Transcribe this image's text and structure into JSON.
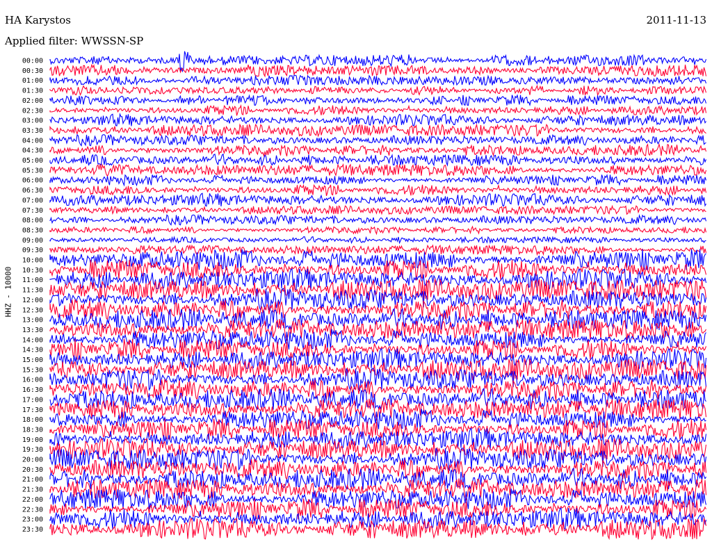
{
  "header": {
    "station": "HA Karystos",
    "date": "2011-11-13",
    "filter": "Applied filter: WWSSN-SP"
  },
  "chart_data": {
    "type": "line",
    "title": "HA Karystos",
    "subtitle": "Applied filter: WWSSN-SP",
    "date": "2011-11-13",
    "ylabel": "HHZ - 10000",
    "xlabel": "",
    "row_start_labels": [
      "00:00",
      "00:30",
      "01:00",
      "01:30",
      "02:00",
      "02:30",
      "03:00",
      "03:30",
      "04:00",
      "04:30",
      "05:00",
      "05:30",
      "06:00",
      "06:30",
      "07:00",
      "07:30",
      "08:00",
      "08:30",
      "09:00",
      "09:30",
      "10:00",
      "10:30",
      "11:00",
      "11:30",
      "12:00",
      "12:30",
      "13:00",
      "13:30",
      "14:00",
      "14:30",
      "15:00",
      "15:30",
      "16:00",
      "16:30",
      "17:00",
      "17:30",
      "18:00",
      "18:30",
      "19:00",
      "19:30",
      "20:00",
      "20:30",
      "21:00",
      "21:30",
      "22:00",
      "22:30",
      "23:00",
      "23:30"
    ],
    "row_colors": [
      "#0000ff",
      "#ff0033"
    ],
    "row_relative_amplitude": [
      0.55,
      0.6,
      0.5,
      0.45,
      0.5,
      0.5,
      0.55,
      0.55,
      0.5,
      0.55,
      0.55,
      0.55,
      0.5,
      0.55,
      0.6,
      0.4,
      0.45,
      0.35,
      0.3,
      0.45,
      1.0,
      1.0,
      1.0,
      1.0,
      1.0,
      1.0,
      1.0,
      1.0,
      1.0,
      1.0,
      1.0,
      1.0,
      1.0,
      1.0,
      1.0,
      1.0,
      1.0,
      1.0,
      1.0,
      1.0,
      1.0,
      1.0,
      1.0,
      1.0,
      1.0,
      1.0,
      1.0,
      1.0
    ],
    "events": [
      {
        "row_label": "00:00",
        "position_fraction": 0.2,
        "relative_amplitude": 4.0
      }
    ]
  }
}
